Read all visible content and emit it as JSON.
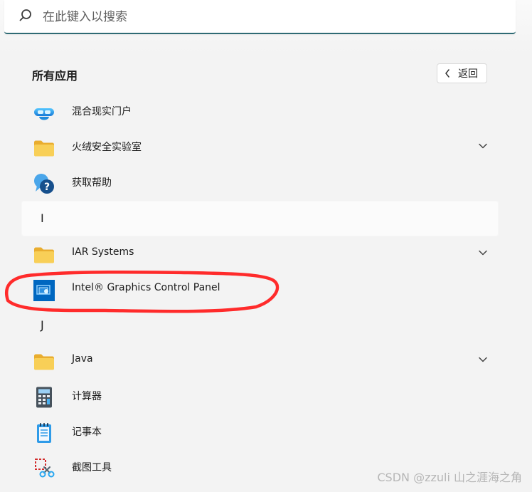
{
  "search": {
    "placeholder": "在此键入以搜索",
    "value": ""
  },
  "section": {
    "title": "所有应用",
    "back_label": "返回"
  },
  "apps": [
    {
      "type": "app",
      "label": "混合现实门户",
      "icon": "mixed-reality-icon"
    },
    {
      "type": "folder",
      "label": "火绒安全实验室",
      "icon": "folder-icon",
      "expandable": true
    },
    {
      "type": "app",
      "label": "获取帮助",
      "icon": "help-icon"
    },
    {
      "type": "letter",
      "label": "I"
    },
    {
      "type": "folder",
      "label": "IAR Systems",
      "icon": "folder-icon",
      "expandable": true
    },
    {
      "type": "app",
      "label": "Intel® Graphics Control Panel",
      "icon": "intel-graphics-icon"
    },
    {
      "type": "letter",
      "label": "J"
    },
    {
      "type": "folder",
      "label": "Java",
      "icon": "folder-icon",
      "expandable": true
    },
    {
      "type": "app",
      "label": "计算器",
      "icon": "calculator-icon"
    },
    {
      "type": "app",
      "label": "记事本",
      "icon": "notepad-icon"
    },
    {
      "type": "app",
      "label": "截图工具",
      "icon": "snipping-tool-icon"
    }
  ],
  "colors": {
    "search_underline": "#2f6b74",
    "intel_blue": "#0069c4",
    "annotation_red": "#ff2b2b",
    "folder_yellow": "#f7c948"
  },
  "watermark": "CSDN @zzuli 山之涯海之角"
}
